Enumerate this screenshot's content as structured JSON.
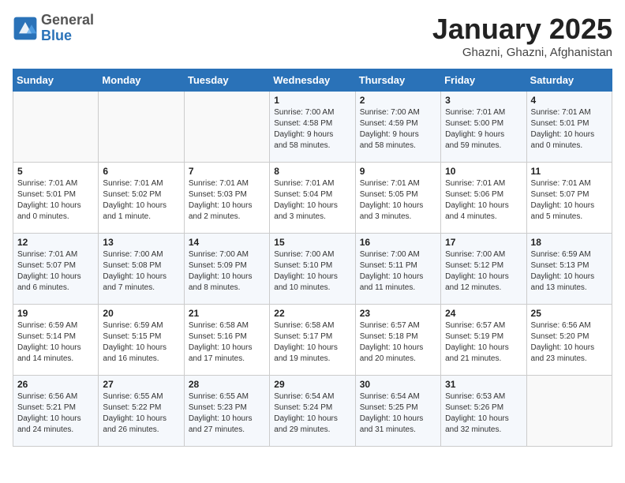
{
  "header": {
    "logo": {
      "general": "General",
      "blue": "Blue"
    },
    "title": "January 2025",
    "subtitle": "Ghazni, Ghazni, Afghanistan"
  },
  "days_of_week": [
    "Sunday",
    "Monday",
    "Tuesday",
    "Wednesday",
    "Thursday",
    "Friday",
    "Saturday"
  ],
  "weeks": [
    [
      {
        "day": "",
        "info": ""
      },
      {
        "day": "",
        "info": ""
      },
      {
        "day": "",
        "info": ""
      },
      {
        "day": "1",
        "info": "Sunrise: 7:00 AM\nSunset: 4:58 PM\nDaylight: 9 hours\nand 58 minutes."
      },
      {
        "day": "2",
        "info": "Sunrise: 7:00 AM\nSunset: 4:59 PM\nDaylight: 9 hours\nand 58 minutes."
      },
      {
        "day": "3",
        "info": "Sunrise: 7:01 AM\nSunset: 5:00 PM\nDaylight: 9 hours\nand 59 minutes."
      },
      {
        "day": "4",
        "info": "Sunrise: 7:01 AM\nSunset: 5:01 PM\nDaylight: 10 hours\nand 0 minutes."
      }
    ],
    [
      {
        "day": "5",
        "info": "Sunrise: 7:01 AM\nSunset: 5:01 PM\nDaylight: 10 hours\nand 0 minutes."
      },
      {
        "day": "6",
        "info": "Sunrise: 7:01 AM\nSunset: 5:02 PM\nDaylight: 10 hours\nand 1 minute."
      },
      {
        "day": "7",
        "info": "Sunrise: 7:01 AM\nSunset: 5:03 PM\nDaylight: 10 hours\nand 2 minutes."
      },
      {
        "day": "8",
        "info": "Sunrise: 7:01 AM\nSunset: 5:04 PM\nDaylight: 10 hours\nand 3 minutes."
      },
      {
        "day": "9",
        "info": "Sunrise: 7:01 AM\nSunset: 5:05 PM\nDaylight: 10 hours\nand 3 minutes."
      },
      {
        "day": "10",
        "info": "Sunrise: 7:01 AM\nSunset: 5:06 PM\nDaylight: 10 hours\nand 4 minutes."
      },
      {
        "day": "11",
        "info": "Sunrise: 7:01 AM\nSunset: 5:07 PM\nDaylight: 10 hours\nand 5 minutes."
      }
    ],
    [
      {
        "day": "12",
        "info": "Sunrise: 7:01 AM\nSunset: 5:07 PM\nDaylight: 10 hours\nand 6 minutes."
      },
      {
        "day": "13",
        "info": "Sunrise: 7:00 AM\nSunset: 5:08 PM\nDaylight: 10 hours\nand 7 minutes."
      },
      {
        "day": "14",
        "info": "Sunrise: 7:00 AM\nSunset: 5:09 PM\nDaylight: 10 hours\nand 8 minutes."
      },
      {
        "day": "15",
        "info": "Sunrise: 7:00 AM\nSunset: 5:10 PM\nDaylight: 10 hours\nand 10 minutes."
      },
      {
        "day": "16",
        "info": "Sunrise: 7:00 AM\nSunset: 5:11 PM\nDaylight: 10 hours\nand 11 minutes."
      },
      {
        "day": "17",
        "info": "Sunrise: 7:00 AM\nSunset: 5:12 PM\nDaylight: 10 hours\nand 12 minutes."
      },
      {
        "day": "18",
        "info": "Sunrise: 6:59 AM\nSunset: 5:13 PM\nDaylight: 10 hours\nand 13 minutes."
      }
    ],
    [
      {
        "day": "19",
        "info": "Sunrise: 6:59 AM\nSunset: 5:14 PM\nDaylight: 10 hours\nand 14 minutes."
      },
      {
        "day": "20",
        "info": "Sunrise: 6:59 AM\nSunset: 5:15 PM\nDaylight: 10 hours\nand 16 minutes."
      },
      {
        "day": "21",
        "info": "Sunrise: 6:58 AM\nSunset: 5:16 PM\nDaylight: 10 hours\nand 17 minutes."
      },
      {
        "day": "22",
        "info": "Sunrise: 6:58 AM\nSunset: 5:17 PM\nDaylight: 10 hours\nand 19 minutes."
      },
      {
        "day": "23",
        "info": "Sunrise: 6:57 AM\nSunset: 5:18 PM\nDaylight: 10 hours\nand 20 minutes."
      },
      {
        "day": "24",
        "info": "Sunrise: 6:57 AM\nSunset: 5:19 PM\nDaylight: 10 hours\nand 21 minutes."
      },
      {
        "day": "25",
        "info": "Sunrise: 6:56 AM\nSunset: 5:20 PM\nDaylight: 10 hours\nand 23 minutes."
      }
    ],
    [
      {
        "day": "26",
        "info": "Sunrise: 6:56 AM\nSunset: 5:21 PM\nDaylight: 10 hours\nand 24 minutes."
      },
      {
        "day": "27",
        "info": "Sunrise: 6:55 AM\nSunset: 5:22 PM\nDaylight: 10 hours\nand 26 minutes."
      },
      {
        "day": "28",
        "info": "Sunrise: 6:55 AM\nSunset: 5:23 PM\nDaylight: 10 hours\nand 27 minutes."
      },
      {
        "day": "29",
        "info": "Sunrise: 6:54 AM\nSunset: 5:24 PM\nDaylight: 10 hours\nand 29 minutes."
      },
      {
        "day": "30",
        "info": "Sunrise: 6:54 AM\nSunset: 5:25 PM\nDaylight: 10 hours\nand 31 minutes."
      },
      {
        "day": "31",
        "info": "Sunrise: 6:53 AM\nSunset: 5:26 PM\nDaylight: 10 hours\nand 32 minutes."
      },
      {
        "day": "",
        "info": ""
      }
    ]
  ]
}
